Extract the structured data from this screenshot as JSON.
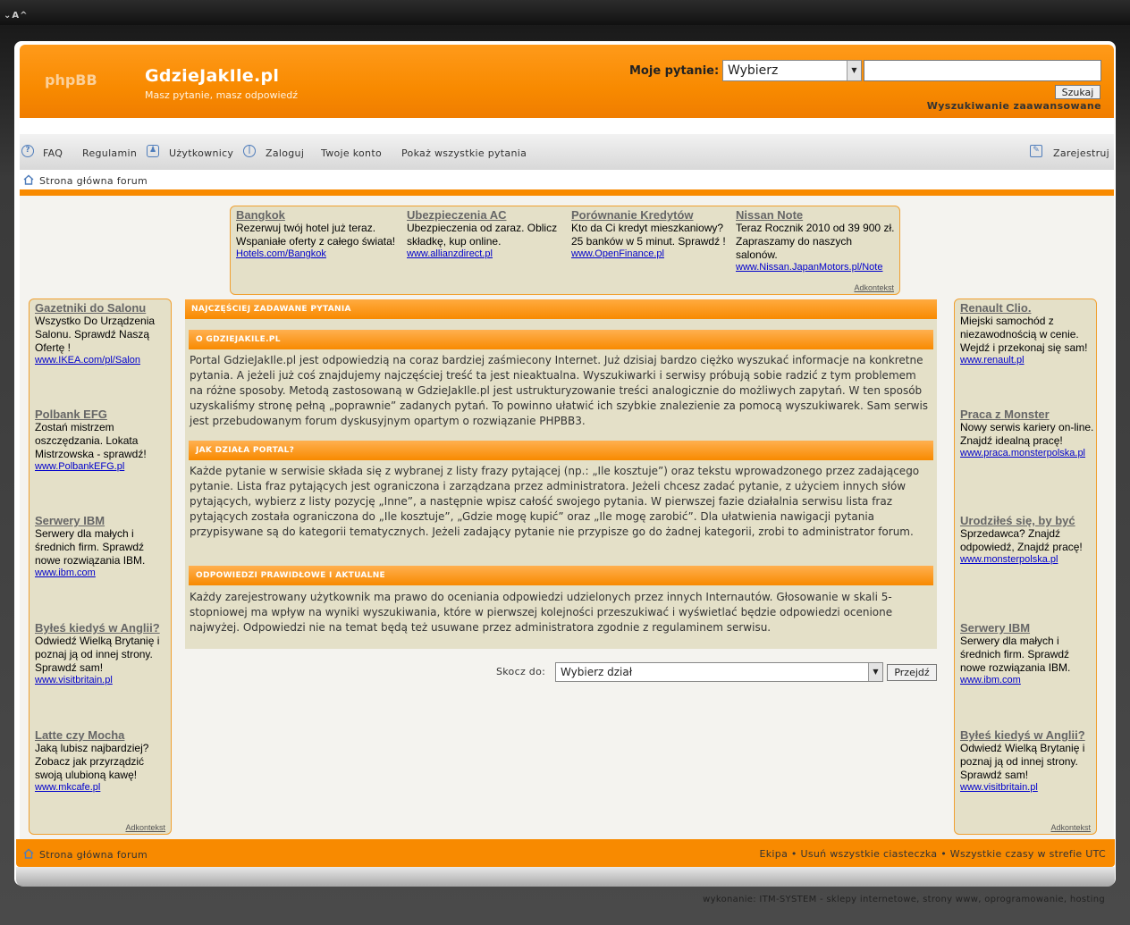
{
  "header": {
    "logo_text": "phpBB",
    "site_title": "GdzieJakIle.pl",
    "site_description": "Masz pytanie, masz odpowiedź",
    "question_label": "Moje pytanie:",
    "question_select_value": "Wybierz",
    "search_button": "Szukaj",
    "advanced_search": "Wyszukiwanie zaawansowane"
  },
  "nav": {
    "faq": "FAQ",
    "rules": "Regulamin",
    "users": "Użytkownicy",
    "login": "Zaloguj",
    "account": "Twoje konto",
    "all_questions": "Pokaż wszystkie pytania",
    "register": "Zarejestruj"
  },
  "breadcrumb": "Strona główna forum",
  "top_ads": [
    {
      "title": "Bangkok",
      "text": "Rezerwuj twój hotel już teraz. Wspaniałe oferty z całego świata!",
      "url": "Hotels.com/Bangkok"
    },
    {
      "title": "Ubezpieczenia AC",
      "text": "Ubezpieczenia od zaraz. Oblicz składkę, kup online.",
      "url": "www.allianzdirect.pl"
    },
    {
      "title": "Porównanie Kredytów",
      "text": "Kto da Ci kredyt mieszkaniowy? 25 banków w 5 minut. Sprawdź !",
      "url": "www.OpenFinance.pl"
    },
    {
      "title": "Nissan Note",
      "text": "Teraz Rocznik 2010 od 39 900 zł. Zapraszamy do naszych salonów.",
      "url": "www.Nissan.JapanMotors.pl/Note"
    }
  ],
  "adkontekst_label": "Adkontekst",
  "left_ads": [
    {
      "title": "Gazetniki do Salonu",
      "text": "Wszystko Do Urządzenia Salonu. Sprawdź Naszą Ofertę !",
      "url": "www.IKEA.com/pl/Salon"
    },
    {
      "title": "Polbank EFG",
      "text": "Zostań mistrzem oszczędzania. Lokata Mistrzowska - sprawdź!",
      "url": "www.PolbankEFG.pl"
    },
    {
      "title": "Serwery IBM",
      "text": "Serwery dla małych i średnich firm. Sprawdź nowe rozwiązania IBM.",
      "url": "www.ibm.com"
    },
    {
      "title": "Byłeś kiedyś w Anglii?",
      "text": "Odwiedź Wielką Brytanię i poznaj ją od innej strony. Sprawdź sam!",
      "url": "www.visitbritain.pl"
    },
    {
      "title": "Latte czy Mocha",
      "text": "Jaką lubisz najbardziej? Zobacz jak przyrządzić swoją ulubioną kawę!",
      "url": "www.mkcafe.pl"
    }
  ],
  "right_ads": [
    {
      "title": "Renault Clio.",
      "text": "Miejski samochód z niezawodnością w cenie. Wejdź i przekonaj się sam!",
      "url": "www.renault.pl"
    },
    {
      "title": "Praca z Monster",
      "text": "Nowy serwis kariery on-line. Znajdź idealną pracę!",
      "url": "www.praca.monsterpolska.pl"
    },
    {
      "title": "Urodziłeś się, by być",
      "text": "Sprzedawca? Znajdź odpowiedź, Znajdź pracę!",
      "url": "www.monsterpolska.pl"
    },
    {
      "title": "Serwery IBM",
      "text": "Serwery dla małych i średnich firm. Sprawdź nowe rozwiązania IBM.",
      "url": "www.ibm.com"
    },
    {
      "title": "Byłeś kiedyś w Anglii?",
      "text": "Odwiedź Wielką Brytanię i poznaj ją od innej strony. Sprawdź sam!",
      "url": "www.visitbritain.pl"
    }
  ],
  "main": {
    "heading": "NAJCZĘŚCIEJ ZADAWANE PYTANIA",
    "sections": [
      {
        "title": "O GDZIEJAKILE.PL",
        "text": "Portal GdzieJakIle.pl jest odpowiedzią na coraz bardziej zaśmiecony Internet. Już dzisiaj bardzo ciężko wyszukać informacje na konkretne pytania. A jeżeli już coś znajdujemy najczęściej treść ta jest nieaktualna. Wyszukiwarki i serwisy próbują sobie radzić z tym problemem na różne sposoby. Metodą zastosowaną w GdzieJakIle.pl jest ustrukturyzowanie treści analogicznie do możliwych zapytań. W ten sposób uzyskaliśmy stronę pełną „poprawnie” zadanych pytań. To powinno ułatwić ich szybkie znalezienie za pomocą wyszukiwarek. Sam serwis jest przebudowanym forum dyskusyjnym opartym o rozwiązanie PHPBB3."
      },
      {
        "title": "JAK DZIAŁA PORTAL?",
        "text": "Każde pytanie w serwisie składa się z wybranej z listy frazy pytającej (np.: „Ile kosztuje”) oraz tekstu wprowadzonego przez zadającego pytanie. Lista fraz pytających jest ograniczona i zarządzana przez administratora. Jeżeli chcesz zadać pytanie, z użyciem innych słów pytających, wybierz z listy pozycję „Inne”, a następnie wpisz całość swojego pytania. W pierwszej fazie działalnia serwisu lista fraz pytających została ograniczona do „Ile kosztuje”, „Gdzie mogę kupić” oraz „Ile mogę zarobić”. Dla ułatwienia nawigacji pytania przypisywane są do kategorii tematycznych. Jeżeli zadający pytanie nie przypisze go do żadnej kategorii, zrobi to administrator forum."
      },
      {
        "title": "ODPOWIEDZI PRAWIDŁOWE I AKTUALNE",
        "text": "Każdy zarejestrowany użytkownik ma prawo do oceniania odpowiedzi udzielonych przez innych Internautów. Głosowanie w skali 5-stopniowej ma wpływ na wyniki wyszukiwania, które w pierwszej kolejności przeszukiwać i wyświetlać będzie odpowiedzi ocenione najwyżej. Odpowiedzi nie na temat będą też usuwane przez administratora zgodnie z regulaminem serwisu."
      }
    ]
  },
  "jump": {
    "label": "Skocz do:",
    "select_value": "Wybierz dział",
    "button": "Przejdź"
  },
  "footer": {
    "home": "Strona główna forum",
    "team": "Ekipa",
    "delete_cookies": "Usuń wszystkie ciasteczka",
    "timezone": "Wszystkie czasy w strefie UTC",
    "separator": "•"
  },
  "credit": "wykonanie: ITM-SYSTEM - sklepy internetowe, strony www, oprogramowanie, hosting",
  "topbar_text": "⌄A^"
}
